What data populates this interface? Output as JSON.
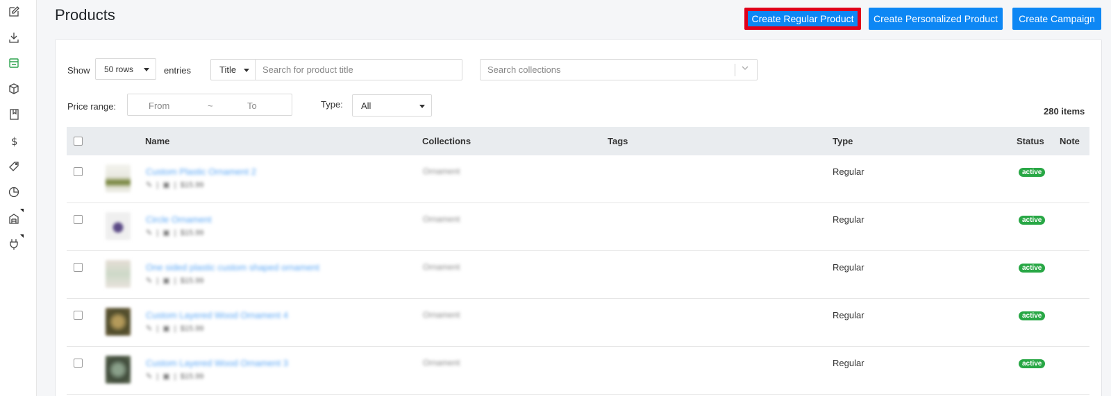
{
  "sidebar": {
    "icons": [
      "edit-icon",
      "download-icon",
      "store-icon",
      "box-icon",
      "book-icon",
      "dollar-icon",
      "tag-icon",
      "chart-pie-icon",
      "warehouse-icon",
      "plug-icon"
    ],
    "active_color": "#2ea44f"
  },
  "header": {
    "title": "Products",
    "buttons": {
      "create_regular": "Create Regular Product",
      "create_personalized": "Create Personalized Product",
      "create_campaign": "Create Campaign"
    }
  },
  "filters": {
    "show_label": "Show",
    "rows_value": "50 rows",
    "entries_label": "entries",
    "search_field": "Title",
    "search_placeholder": "Search for product title",
    "collections_placeholder": "Search collections",
    "price_label": "Price range:",
    "price_from": "From",
    "price_sep": "~",
    "price_to": "To",
    "type_label": "Type:",
    "type_value": "All",
    "items_count": "280 items"
  },
  "table": {
    "headers": {
      "name": "Name",
      "collections": "Collections",
      "tags": "Tags",
      "type": "Type",
      "status": "Status",
      "note": "Note"
    },
    "rows": [
      {
        "name": "Custom Plastic Ornament 2",
        "meta": "$15.99",
        "collection": "Ornament",
        "type": "Regular",
        "status": "active"
      },
      {
        "name": "Circle Ornament",
        "meta": "$15.99",
        "collection": "Ornament",
        "type": "Regular",
        "status": "active"
      },
      {
        "name": "One sided plastic custom shaped ornament",
        "meta": "$15.99",
        "collection": "Ornament",
        "type": "Regular",
        "status": "active"
      },
      {
        "name": "Custom Layered Wood Ornament 4",
        "meta": "$15.99",
        "collection": "Ornament",
        "type": "Regular",
        "status": "active"
      },
      {
        "name": "Custom Layered Wood Ornament 3",
        "meta": "$15.99",
        "collection": "Ornament",
        "type": "Regular",
        "status": "active"
      }
    ]
  },
  "colors": {
    "primary_button": "#0d87f4",
    "highlight_outline": "#e0001a",
    "status_active": "#28a745",
    "link": "#5aa6f5"
  }
}
